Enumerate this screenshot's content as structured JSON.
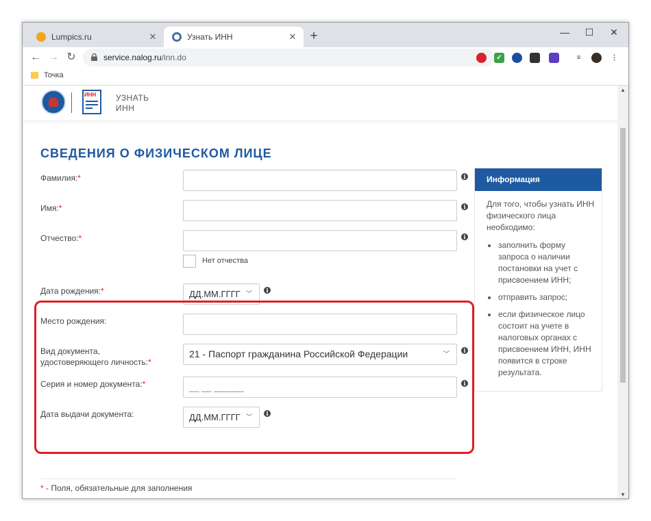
{
  "browser": {
    "tabs": [
      {
        "title": "Lumpics.ru",
        "favicon_color": "#f4a51c"
      },
      {
        "title": "Узнать ИНН",
        "favicon_color": "#4a6fa5"
      }
    ],
    "new_tab": "+",
    "window_controls": [
      "—",
      "☐",
      "✕"
    ],
    "url_host": "service.nalog.ru",
    "url_path": "/inn.do",
    "bookmark": "Точка"
  },
  "header": {
    "logo_text": "ИНН",
    "title_line1": "УЗНАТЬ",
    "title_line2": "ИНН"
  },
  "form": {
    "title": "СВЕДЕНИЯ О ФИЗИЧЕСКОМ ЛИЦЕ",
    "required_mark": "*",
    "surname_label": "Фамилия:",
    "name_label": "Имя:",
    "patronymic_label": "Отчество:",
    "no_patronymic_label": "Нет отчества",
    "birthdate_label": "Дата рождения:",
    "birthdate_placeholder": "ДД.ММ.ГГГГ",
    "birthplace_label": "Место рождения:",
    "doctype_label_line1": "Вид документа,",
    "doctype_label_line2": "удостоверяющего личность:",
    "doctype_value": "21 - Паспорт гражданина Российской Федерации",
    "docnum_label": "Серия и номер документа:",
    "docnum_mask": "__ __ ______",
    "issue_date_label": "Дата выдачи документа:",
    "issue_date_placeholder": "ДД.ММ.ГГГГ",
    "footnote": " - Поля, обязательные для заполнения"
  },
  "info": {
    "heading": "Информация",
    "intro": "Для того, чтобы узнать ИНН физического лица необходимо:",
    "items": [
      "заполнить форму запроса о наличии постановки на учет с присвоением ИНН;",
      "отправить запрос;",
      "если физическое лицо состоит на учете в налоговых органах с присвоением ИНН, ИНН появится в строке результата."
    ]
  },
  "colors": {
    "accent": "#1e5aa0",
    "required": "#d9232d",
    "highlight": "#e21d24"
  }
}
